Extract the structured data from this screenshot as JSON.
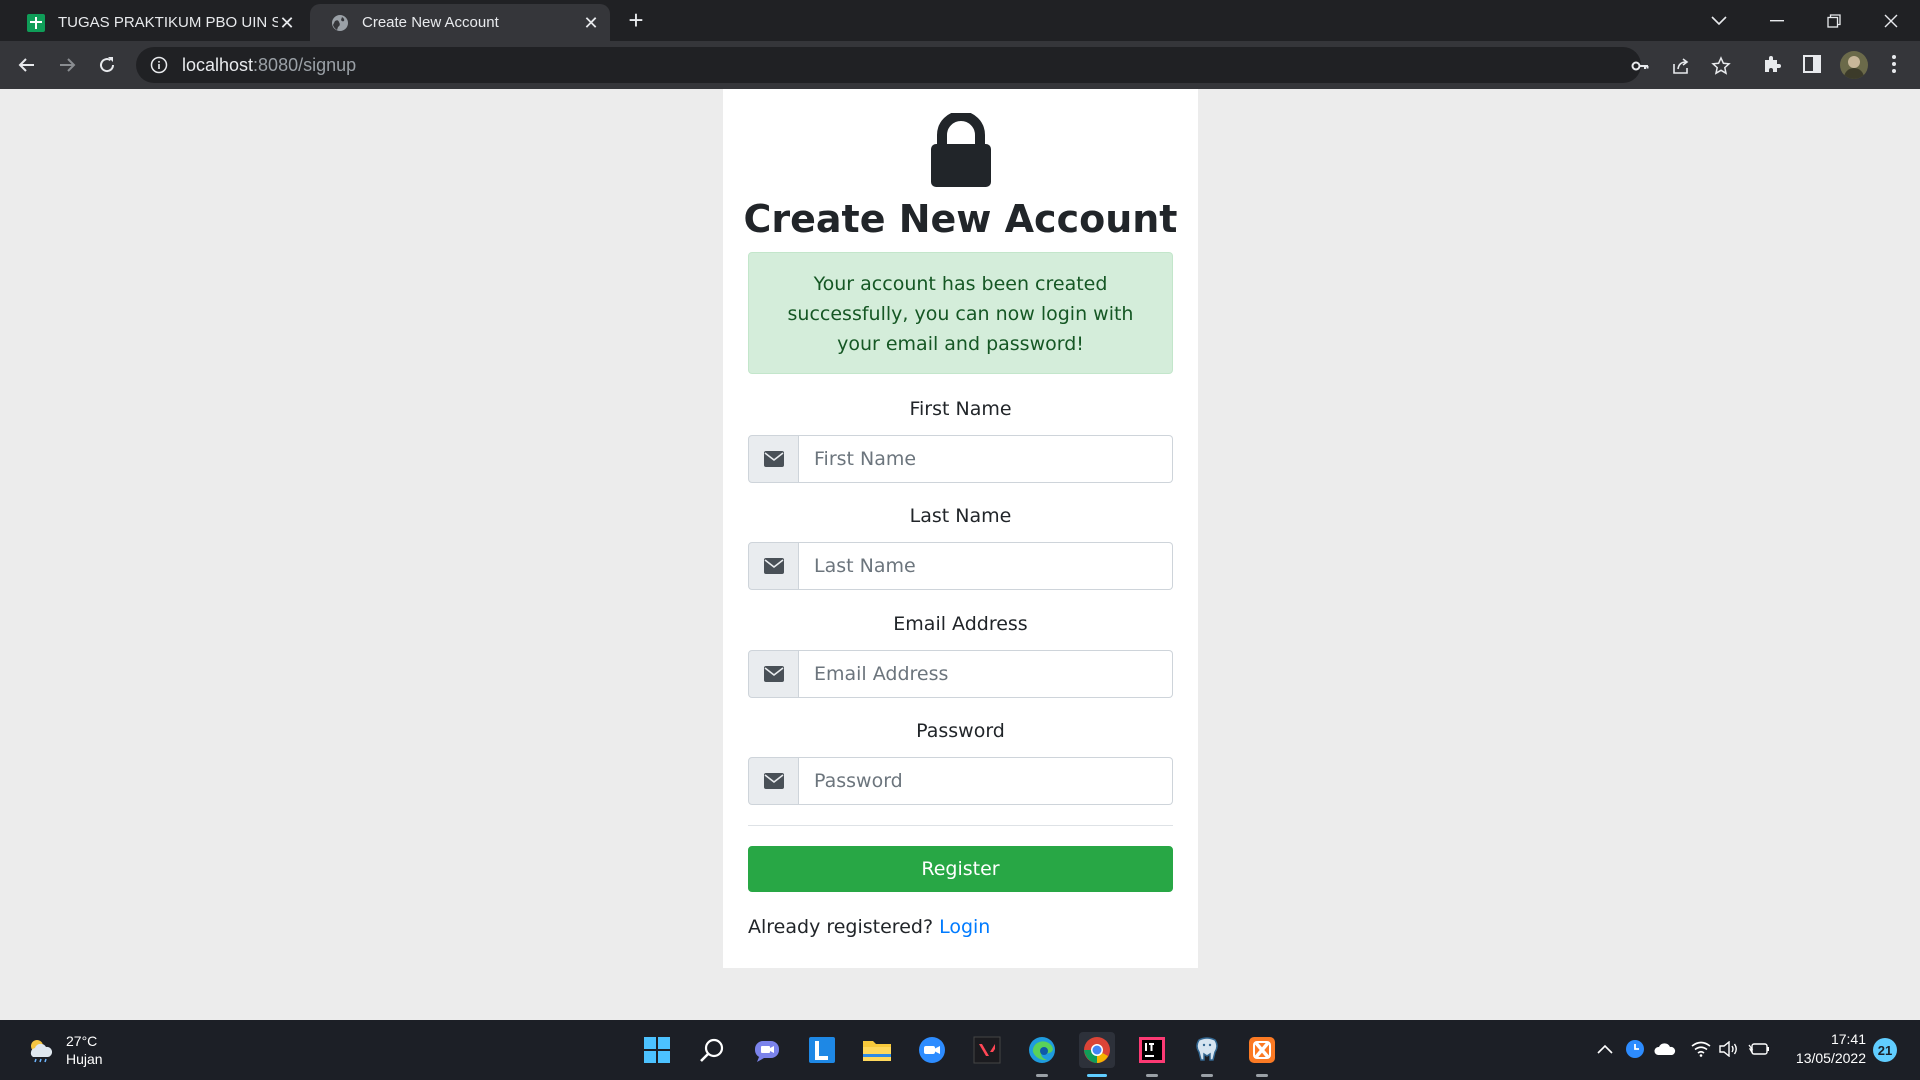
{
  "browser": {
    "tabs": [
      {
        "title": "TUGAS PRAKTIKUM PBO UIN SGD",
        "active": false,
        "icon": "sheets-icon"
      },
      {
        "title": "Create New Account",
        "active": true,
        "icon": "globe-icon"
      }
    ],
    "url_host": "localhost",
    "url_path": ":8080/signup"
  },
  "page": {
    "heading": "Create New Account",
    "alert": "Your account has been created successfully, you can now login with your email and password!",
    "fields": [
      {
        "label": "First Name",
        "placeholder": "First Name"
      },
      {
        "label": "Last Name",
        "placeholder": "Last Name"
      },
      {
        "label": "Email Address",
        "placeholder": "Email Address"
      },
      {
        "label": "Password",
        "placeholder": "Password"
      }
    ],
    "register_label": "Register",
    "already_text": "Already registered?",
    "login_link": "Login",
    "colors": {
      "success": "#28a745",
      "alert_bg": "#d4edda",
      "link": "#007bff"
    }
  },
  "taskbar": {
    "weather_temp": "27°C",
    "weather_desc": "Hujan",
    "time": "17:41",
    "date": "13/05/2022",
    "notification_count": "21"
  }
}
